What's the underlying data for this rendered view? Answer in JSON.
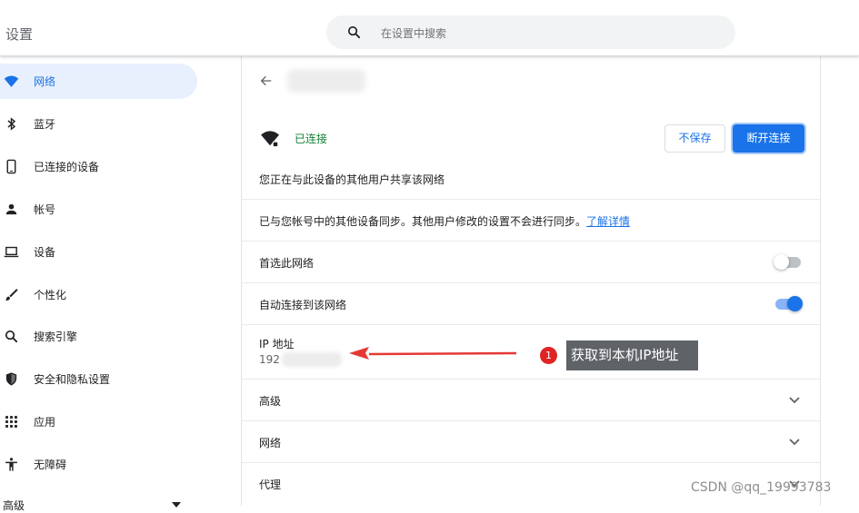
{
  "app": {
    "title": "设置"
  },
  "search": {
    "placeholder": "在设置中搜索",
    "icon": "search-icon"
  },
  "sidebar": {
    "items": [
      {
        "label": "网络",
        "icon": "wifi-icon",
        "active": true
      },
      {
        "label": "蓝牙",
        "icon": "bluetooth-icon"
      },
      {
        "label": "已连接的设备",
        "icon": "phone-icon"
      },
      {
        "label": "帐号",
        "icon": "person-icon"
      },
      {
        "label": "设备",
        "icon": "laptop-icon"
      },
      {
        "label": "个性化",
        "icon": "brush-icon"
      },
      {
        "label": "搜索引擎",
        "icon": "search-icon"
      },
      {
        "label": "安全和隐私设置",
        "icon": "shield-icon"
      },
      {
        "label": "应用",
        "icon": "apps-grid-icon"
      },
      {
        "label": "无障碍",
        "icon": "accessibility-icon"
      }
    ],
    "advanced_label": "高级"
  },
  "network": {
    "status": "已连接",
    "forget_label": "不保存",
    "disconnect_label": "断开连接",
    "sharing_note": "您正在与此设备的其他用户共享该网络",
    "sync_note": "已与您帐号中的其他设备同步。其他用户修改的设置不会进行同步。",
    "learn_more": "了解详情",
    "prefer_label": "首选此网络",
    "prefer_enabled": false,
    "autoconnect_label": "自动连接到该网络",
    "autoconnect_enabled": true,
    "ip_label": "IP 地址",
    "ip_visible_prefix": "192",
    "sections": [
      "高级",
      "网络",
      "代理"
    ]
  },
  "annotation": {
    "number": "1",
    "text": "获取到本机IP地址",
    "badge_color": "#e02424",
    "arrow_color": "#e53935"
  },
  "watermark": "CSDN @qq_19993783",
  "colors": {
    "accent": "#1a73e8",
    "connected": "#188038",
    "active_bg": "#e8f0fe"
  }
}
